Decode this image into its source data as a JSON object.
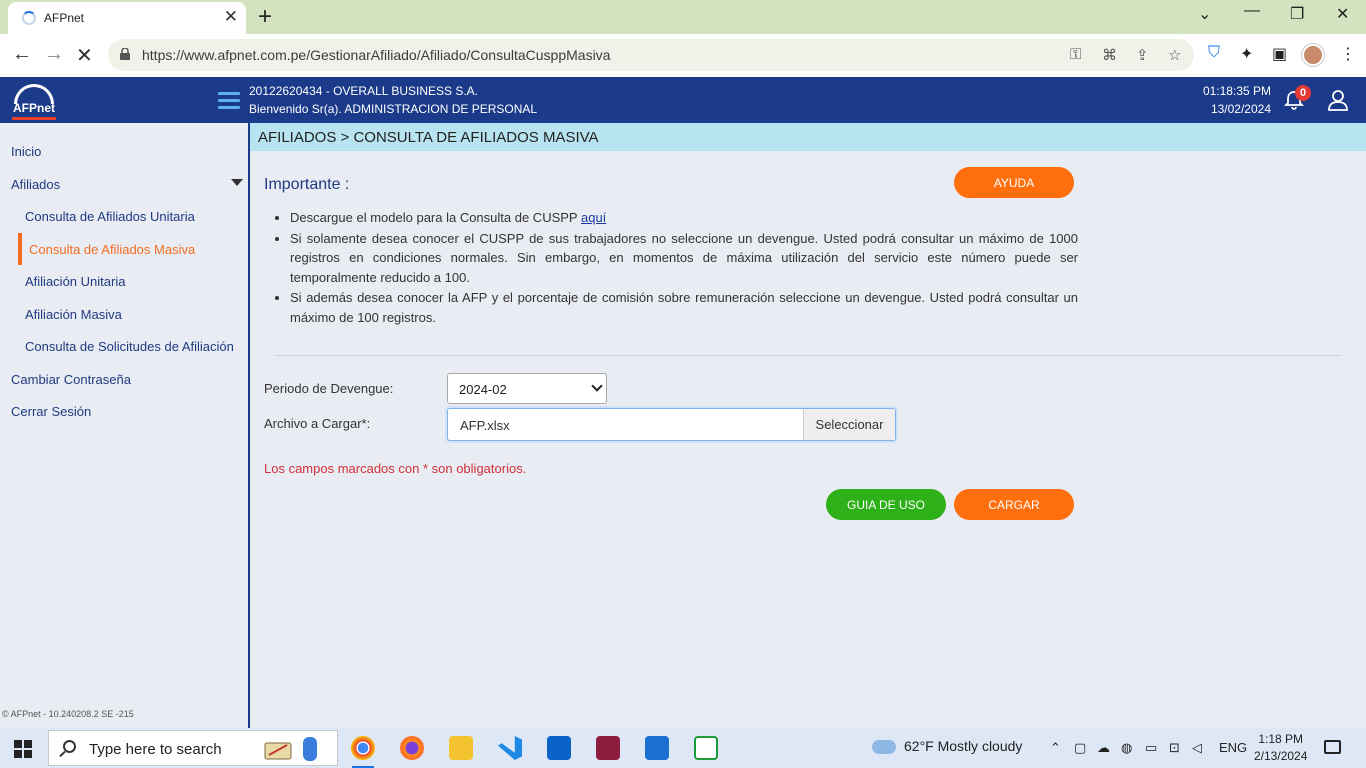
{
  "browser": {
    "tab_title": "AFPnet",
    "new_tab": "+",
    "url": "https://www.afpnet.com.pe/GestionarAfiliado/Afiliado/ConsultaCusppMasiva"
  },
  "header": {
    "logo_text": "AFPnet",
    "company": "20122620434 - OVERALL BUSINESS S.A.",
    "welcome": "Bienvenido Sr(a). ADMINISTRACION DE PERSONAL",
    "time": "01:18:35 PM",
    "date": "13/02/2024",
    "notification_count": "0"
  },
  "sidebar": {
    "items": [
      {
        "label": "Inicio"
      },
      {
        "label": "Afiliados"
      },
      {
        "label": "Consulta de Afiliados Unitaria"
      },
      {
        "label": "Consulta de Afiliados Masiva"
      },
      {
        "label": "Afiliación Unitaria"
      },
      {
        "label": "Afiliación Masiva"
      },
      {
        "label": "Consulta de Solicitudes de Afiliación"
      },
      {
        "label": "Cambiar Contraseña"
      },
      {
        "label": "Cerrar Sesión"
      }
    ],
    "version": "© AFPnet - 10.240208.2 SE -215"
  },
  "main": {
    "breadcrumb": "AFILIADOS > CONSULTA DE AFILIADOS MASIVA",
    "importante": "Importante :",
    "ayuda_label": "AYUDA",
    "bullet1_text": "Descargue el modelo para la Consulta de CUSPP ",
    "bullet1_link": "aquí",
    "bullet2": "Si solamente desea conocer el CUSPP de sus trabajadores no seleccione un devengue. Usted podrá consultar un máximo de 1000 registros en condiciones normales. Sin embargo, en momentos de máxima utilización del servicio este número puede ser temporalmente reducido a 100.",
    "bullet3": "Si además desea conocer la AFP y el porcentaje de comisión sobre remuneración seleccione un devengue. Usted podrá consultar un máximo de 100 registros.",
    "periodo_label": "Periodo de Devengue:",
    "periodo_value": "2024-02",
    "archivo_label": "Archivo a Cargar*:",
    "archivo_value": "AFP.xlsx",
    "seleccionar_label": "Seleccionar",
    "required_note": "Los campos marcados con * son obligatorios.",
    "guia_label": "GUIA DE USO",
    "cargar_label": "CARGAR"
  },
  "taskbar": {
    "search_placeholder": "Type here to search",
    "weather": "62°F  Mostly cloudy",
    "lang": "ENG",
    "time": "1:18 PM",
    "date": "2/13/2024"
  },
  "colors": {
    "header_blue": "#1b3a8a",
    "accent_orange": "#ff6f0e",
    "accent_green": "#2eb019",
    "breadcrumb_bg": "#b7e4f0"
  }
}
